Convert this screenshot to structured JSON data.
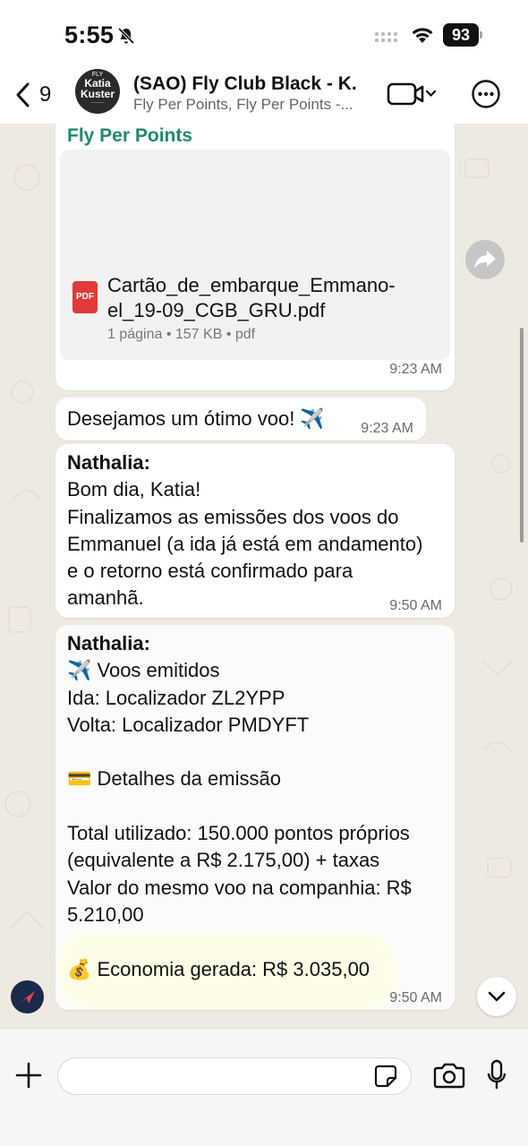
{
  "status_bar": {
    "time": "5:55",
    "battery": "93"
  },
  "header": {
    "back_count": "9",
    "avatar_text": {
      "top": "FLY",
      "name_line1": "Katia",
      "name_line2": "Kuster"
    },
    "title": "(SAO) Fly Club Black - K...",
    "subtitle": "Fly Per Points, Fly Per Points -..."
  },
  "messages": {
    "m1": {
      "sender": "Fly Per Points",
      "file_name": "Cartão_de_embarque_Emmano-el_19-09_CGB_GRU.pdf",
      "file_meta": "1 página • 157 KB • pdf",
      "pdf_badge": "PDF",
      "time": "9:23 AM"
    },
    "m2": {
      "text": "Desejamos um ótimo voo! ✈️",
      "time": "9:23 AM"
    },
    "m3": {
      "author": "Nathalia:",
      "line1": "Bom dia, Katia!",
      "line2": "Finalizamos as emissões dos voos do",
      "line3": "Emmanuel (a ida já está em andamento)",
      "line4": "e o retorno está confirmado para",
      "line5": "amanhã.",
      "time": "9:50 AM"
    },
    "m4": {
      "author": "Nathalia:",
      "line1": "✈️ Voos emitidos",
      "line2": "Ida: Localizador ZL2YPP",
      "line3": "Volta: Localizador PMDYFT",
      "line4": "💳 Detalhes da emissão",
      "line5": "Total utilizado: 150.000 pontos próprios",
      "line6": "(equivalente a R$ 2.175,00) + taxas",
      "line7": "Valor do mesmo voo na companhia: R$",
      "line8": "5.210,00",
      "line9": "💰 Economia gerada: R$ 3.035,00",
      "time": "9:50 AM"
    }
  },
  "input": {
    "placeholder": ""
  },
  "colors": {
    "sender": "#1f8a6e",
    "highlight": "#f5f56a",
    "chat_bg": "#efeae1"
  }
}
